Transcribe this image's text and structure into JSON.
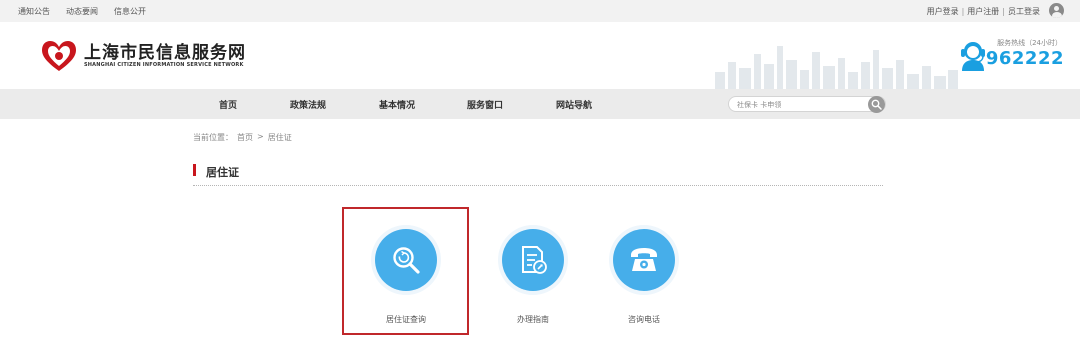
{
  "topbar": {
    "links": [
      "通知公告",
      "动态要闻",
      "信息公开"
    ],
    "auth": [
      "用户登录",
      "用户注册",
      "员工登录"
    ],
    "separator": "|"
  },
  "header": {
    "site_name": "上海市民信息服务网",
    "site_name_en": "SHANGHAI CITIZEN INFORMATION SERVICE NETWORK",
    "hotline_label": "服务热线（24小时）",
    "hotline_number": "962222"
  },
  "nav": {
    "items": [
      "首页",
      "政策法规",
      "基本情况",
      "服务窗口",
      "网站导航"
    ]
  },
  "search": {
    "placeholder": "社保卡 卡申领"
  },
  "breadcrumb": {
    "prefix": "当前位置：",
    "home": "首页",
    "arrow": ">",
    "current": "居住证"
  },
  "section": {
    "title": "居住证"
  },
  "services": [
    {
      "label": "居住证查询",
      "icon": "search-refresh-icon",
      "highlighted": true
    },
    {
      "label": "办理指南",
      "icon": "document-guide-icon",
      "highlighted": false
    },
    {
      "label": "咨询电话",
      "icon": "telephone-icon",
      "highlighted": false
    }
  ],
  "colors": {
    "accent_blue": "#46aeea",
    "hotline_blue": "#1a9fe0",
    "section_red": "#c8161d",
    "highlight_red": "#c0282b"
  }
}
